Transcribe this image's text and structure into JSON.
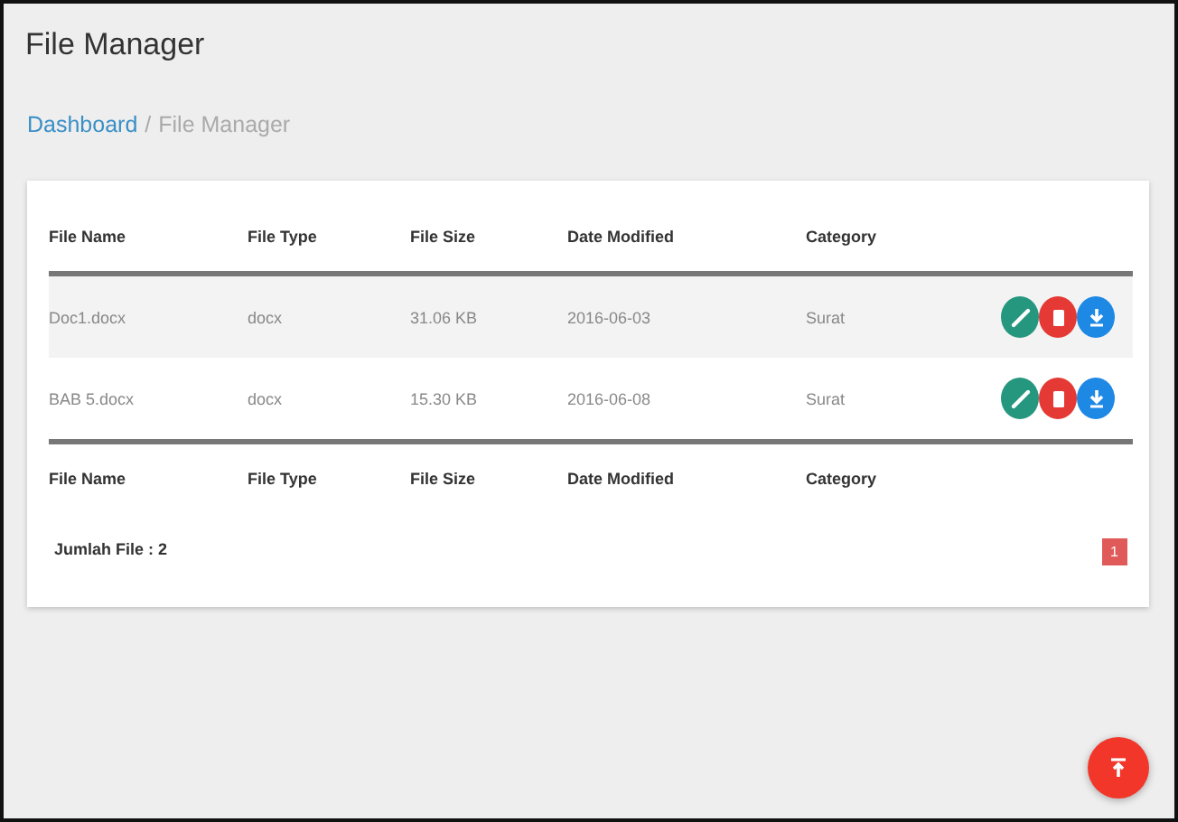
{
  "page_title": "File Manager",
  "breadcrumb": {
    "link": "Dashboard",
    "separator": "/",
    "current": "File Manager"
  },
  "table": {
    "columns": [
      "File Name",
      "File Type",
      "File Size",
      "Date Modified",
      "Category"
    ],
    "rows": [
      {
        "cells": [
          "Doc1.docx",
          "docx",
          "31.06 KB",
          "2016-06-03",
          "Surat"
        ],
        "highlighted": true
      },
      {
        "cells": [
          "BAB 5.docx",
          "docx",
          "15.30 KB",
          "2016-06-08",
          "Surat"
        ],
        "highlighted": false
      }
    ],
    "footer_columns": [
      "File Name",
      "File Type",
      "File Size",
      "Date Modified",
      "Category"
    ]
  },
  "summary": "Jumlah File : 2",
  "pagination": [
    {
      "label": "1",
      "selected": true
    }
  ]
}
